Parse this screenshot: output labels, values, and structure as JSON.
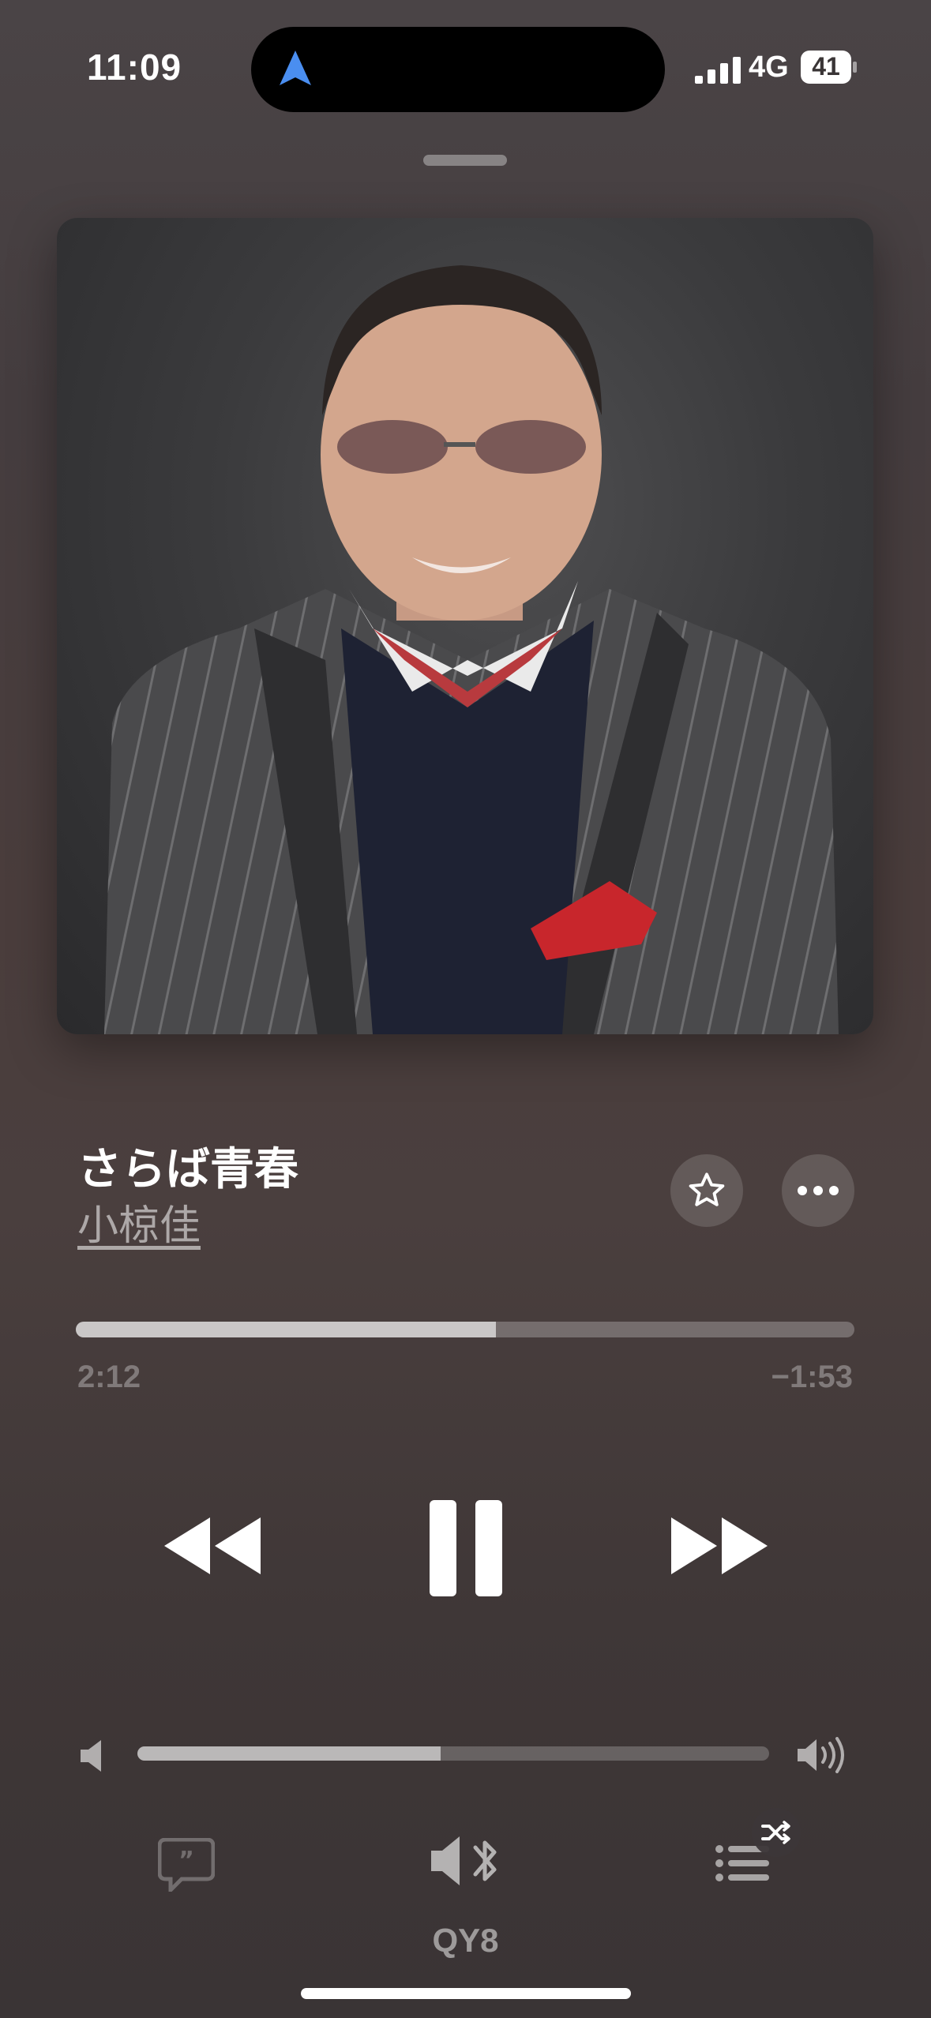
{
  "status_bar": {
    "time": "11:09",
    "network": "4G",
    "battery": "41"
  },
  "now_playing": {
    "title": "さらば青春",
    "artist": "小椋佳",
    "elapsed": "2:12",
    "remaining": "−1:53",
    "progress_fraction": 0.54
  },
  "volume": {
    "level_fraction": 0.48
  },
  "output": {
    "device_name": "QY8"
  },
  "icons": {
    "navigation": "location-arrow-icon",
    "favorite": "star-icon",
    "more": "ellipsis-icon",
    "rewind": "backward-icon",
    "pause": "pause-icon",
    "fast_forward": "forward-icon",
    "lyrics": "lyrics-bubble-icon",
    "output": "speaker-bluetooth-icon",
    "queue": "list-icon",
    "shuffle": "shuffle-icon"
  },
  "colors": {
    "accent_location": "#4a8ef0"
  }
}
